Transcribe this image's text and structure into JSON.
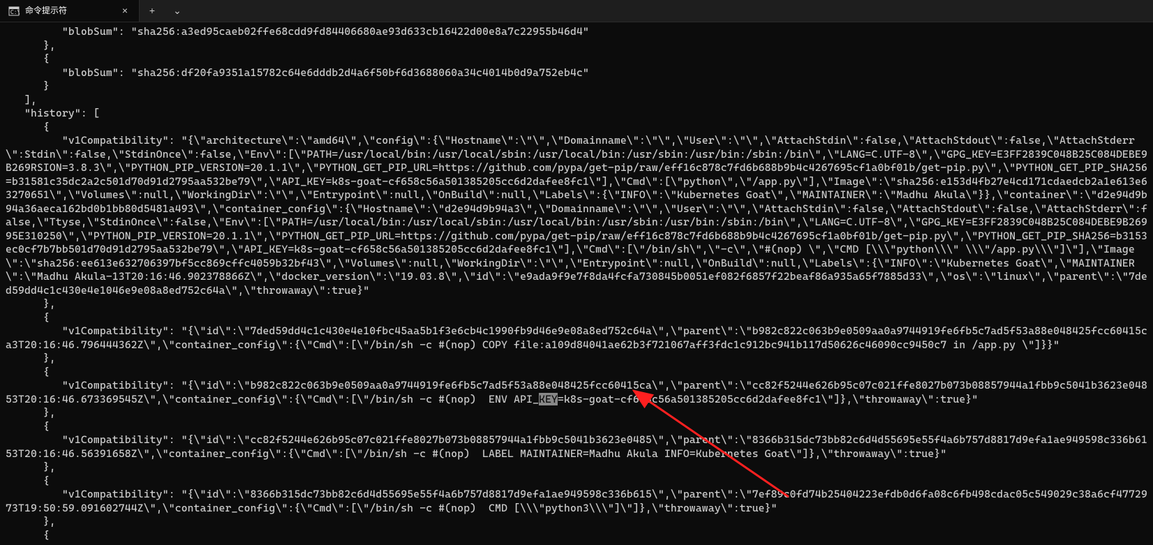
{
  "titlebar": {
    "tab_title": "命令提示符",
    "close_glyph": "×",
    "newtab_glyph": "+",
    "dropdown_glyph": "⌄"
  },
  "terminal_lines": [
    "         \"blobSum\": \"sha256:a3ed95caeb02ffe68cdd9fd84406680ae93d633cb16422d00e8a7c22955b46d4\"",
    "      },",
    "      {",
    "         \"blobSum\": \"sha256:df20fa9351a15782c64e6dddb2d4a6f50bf6d3688060a34c4014b0d9a752eb4c\"",
    "      }",
    "   ],",
    "   \"history\": [",
    "      {",
    "         \"v1Compatibility\": \"{\\\"architecture\\\":\\\"amd64\\\",\\\"config\\\":{\\\"Hostname\\\":\\\"\\\",\\\"Domainname\\\":\\\"\\\",\\\"User\\\":\\\"\\\",\\\"AttachStdin\\\":false,\\\"AttachStdout\\\":false,\\\"AttachStderr\\\":Stdin\\\":false,\\\"StdinOnce\\\":false,\\\"Env\\\":[\\\"PATH=/usr/local/bin:/usr/local/sbin:/usr/local/bin:/usr/sbin:/usr/bin:/sbin:/bin\\\",\\\"LANG=C.UTF-8\\\",\\\"GPG_KEY=E3FF2839C048B25C084DEBE9B269RSION=3.8.3\\\",\\\"PYTHON_PIP_VERSION=20.1.1\\\",\\\"PYTHON_GET_PIP_URL=https://github.com/pypa/get-pip/raw/eff16c878c7fd6b688b9b4c4267695cf1a0bf01b/get-pip.py\\\",\\\"PYTHON_GET_PIP_SHA256=b31581c35dc2a2c501d70d91d2795aa532be79\\\",\\\"API_KEY=k8s-goat-cf658c56a501385205cc6d2dafee8fc1\\\"],\\\"Cmd\\\":[\\\"python\\\",\\\"/app.py\\\"],\\\"Image\\\":\\\"sha256:e153d4fb27e4cd171cdaedcb2a1e613e63270651\\\",\\\"Volumes\\\":null,\\\"WorkingDir\\\":\\\"\\\",\\\"Entrypoint\\\":null,\\\"OnBuild\\\":null,\\\"Labels\\\":{\\\"INFO\\\":\\\"Kubernetes Goat\\\",\\\"MAINTAINER\\\":\\\"Madhu Akula\\\"}},\\\"container\\\":\\\"d2e94d9b94a36aeca162bd0b1bb80d5481a493\\\",\\\"container_config\\\":{\\\"Hostname\\\":\\\"d2e94d9b94a3\\\",\\\"Domainname\\\":\\\"\\\",\\\"User\\\":\\\"\\\",\\\"AttachStdin\\\":false,\\\"AttachStdout\\\":false,\\\"AttachStderr\\\":false,\\\"Ttyse,\\\"StdinOnce\\\":false,\\\"Env\\\":[\\\"PATH=/usr/local/bin:/usr/local/sbin:/usr/local/bin:/usr/sbin:/usr/bin:/sbin:/bin\\\",\\\"LANG=C.UTF-8\\\",\\\"GPG_KEY=E3FF2839C048B25C084DEBE9B26995E310250\\\",\\\"PYTHON_PIP_VERSION=20.1.1\\\",\\\"PYTHON_GET_PIP_URL=https://github.com/pypa/get-pip/raw/eff16c878c7fd6b688b9b4c4267695cf1a0bf01b/get-pip.py\\\",\\\"PYTHON_GET_PIP_SHA256=b3153ec0cf7b7bb501d70d91d2795aa532be79\\\",\\\"API_KEY=k8s-goat-cf658c56a501385205cc6d2dafee8fc1\\\"],\\\"Cmd\\\":[\\\"/bin/sh\\\",\\\"-c\\\",\\\"#(nop) \\\",\\\"CMD [\\\\\\\"python\\\\\\\" \\\\\\\"/app.py\\\\\\\"]\\\"],\\\"Image\\\":\\\"sha256:ee613e632706397bf5cc869cffc4059b32bf43\\\",\\\"Volumes\\\":null,\\\"WorkingDir\\\":\\\"\\\",\\\"Entrypoint\\\":null,\\\"OnBuild\\\":null,\\\"Labels\\\":{\\\"INFO\\\":\\\"Kubernetes Goat\\\",\\\"MAINTAINER\\\":\\\"Madhu Akula-13T20:16:46.902378866Z\\\",\\\"docker_version\\\":\\\"19.03.8\\\",\\\"id\\\":\\\"e9ada9f9e7f8da4fcfa730845b0051ef082f6857f22beaf86a935a65f7885d33\\\",\\\"os\\\":\\\"linux\\\",\\\"parent\\\":\\\"7ded59dd4c1c430e4e1046e9e08a8ed752c64a\\\",\\\"throwaway\\\":true}\"",
    "      },",
    "      {",
    "         \"v1Compatibility\": \"{\\\"id\\\":\\\"7ded59dd4c1c430e4e10fbc45aa5b1f3e6cb4c1990fb9d46e9e08a8ed752c64a\\\",\\\"parent\\\":\\\"b982c822c063b9e0509aa0a9744919fe6fb5c7ad5f53a88e048425fcc60415ca3T20:16:46.796444362Z\\\",\\\"container_config\\\":{\\\"Cmd\\\":[\\\"/bin/sh -c #(nop) COPY file:a109d84041ae62b3f721067aff3fdc1c912bc941b117d50626c46090cc9450c7 in /app.py \\\"]}}\"",
    "      },",
    "      {"
  ],
  "highlighted_line": {
    "prefix": "         \"v1Compatibility\": \"{\\\"id\\\":\\\"b982c822c063b9e0509aa0a9744919fe6fb5c7ad5f53a88e048425fcc60415ca\\\",\\\"parent\\\":\\\"cc82f5244e626b95c07c021ffe8027b073b08857944a1fbb9c5041b3623e04853T20:16:46.673369545Z\\\",\\\"container_config\\\":{\\\"Cmd\\\":[\\\"/bin/sh -c #(nop)  ENV API_",
    "highlight": "KEY",
    "suffix": "=k8s-goat-cf658c56a501385205cc6d2dafee8fc1\\\"]},\\\"throwaway\\\":true}\""
  },
  "terminal_lines_after": [
    "      },",
    "      {",
    "         \"v1Compatibility\": \"{\\\"id\\\":\\\"cc82f5244e626b95c07c021ffe8027b073b08857944a1fbb9c5041b3623e0485\\\",\\\"parent\\\":\\\"8366b315dc73bb82c6d4d55695e55f4a6b757d8817d9efa1ae949598c336b6153T20:16:46.56391658Z\\\",\\\"container_config\\\":{\\\"Cmd\\\":[\\\"/bin/sh -c #(nop)  LABEL MAINTAINER=Madhu Akula INFO=Kubernetes Goat\\\"]},\\\"throwaway\\\":true}\"",
    "      },",
    "      {",
    "         \"v1Compatibility\": \"{\\\"id\\\":\\\"8366b315dc73bb82c6d4d55695e55f4a6b757d8817d9efa1ae949598c336b615\\\",\\\"parent\\\":\\\"7ef89c0fd74b25404223efdb0d6fa08c6fb498cdac05c549029c38a6cf4772973T19:50:59.091602744Z\\\",\\\"container_config\\\":{\\\"Cmd\\\":[\\\"/bin/sh -c #(nop)  CMD [\\\\\\\"python3\\\\\\\"]\\\"]},\\\"throwaway\\\":true}\"",
    "      },",
    "      {"
  ],
  "annotation": {
    "arrow_color": "#ff2020"
  }
}
